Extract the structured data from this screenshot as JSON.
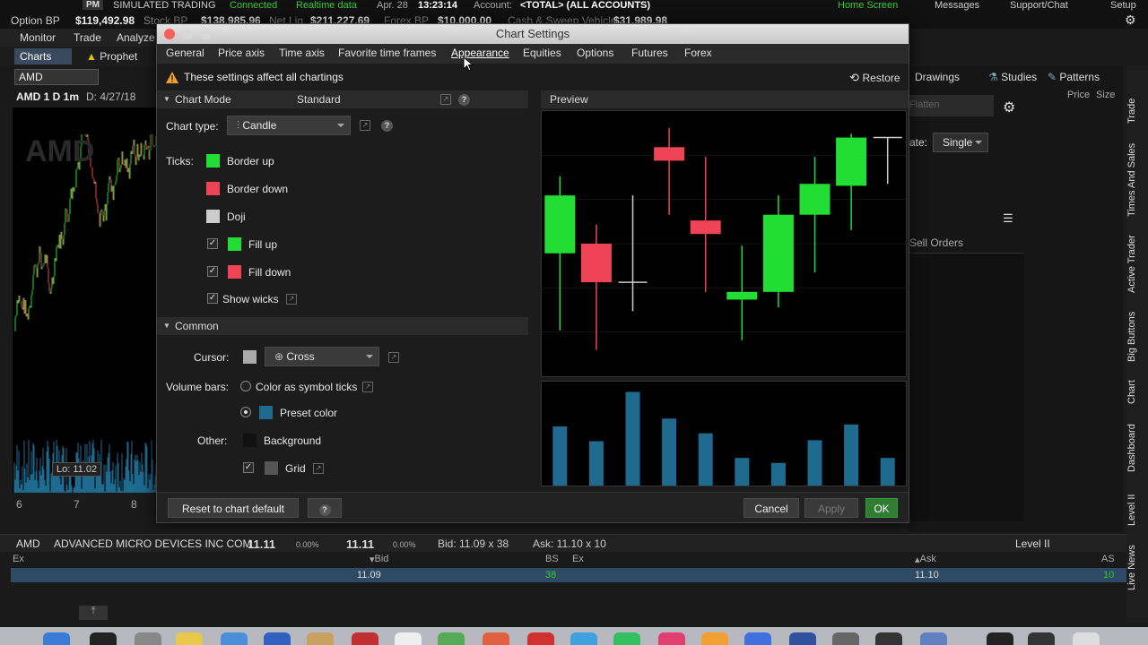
{
  "topbar": {
    "badge": "PM",
    "mode": "SIMULATED TRADING",
    "connected": "Connected",
    "realtime": "Realtime data",
    "date": "Apr. 28",
    "time": "13:23:14",
    "account_label": "Account:",
    "account_value": "<TOTAL> (ALL ACCOUNTS)",
    "home_screen": "Home Screen",
    "messages": "Messages",
    "support": "Support/Chat",
    "setup": "Setup",
    "option_bp_label": "Option BP",
    "option_bp": "$119,492.98",
    "stock_bp_label": "Stock BP",
    "stock_bp": "$138,985.96",
    "net_liq_label": "Net Liq",
    "net_liq": "$211,227.69",
    "forex_bp_label": "Forex BP",
    "forex_bp": "$10,000.00",
    "cash_label": "Cash & Sweep Vehicle",
    "cash": "$31,989.98"
  },
  "nav": {
    "monitor": "Monitor",
    "trade": "Trade",
    "analyze": "Analyze"
  },
  "subtabs": {
    "charts": "Charts",
    "prophet": "Prophet"
  },
  "left": {
    "symbol": "AMD",
    "chart_header_1": "AMD 1 D 1m",
    "chart_header_2": "D: 4/27/18",
    "watermark": "AMD",
    "lo_label": "Lo: 11.02",
    "x_ticks": [
      "6",
      "7",
      "8"
    ]
  },
  "right": {
    "drawings": "Drawings",
    "studies": "Studies",
    "patterns": "Patterns",
    "price": "Price",
    "size": "Size",
    "flatten": "Flatten",
    "rate_label": "ate:",
    "rate_value": "Single",
    "sell_orders": "Sell Orders"
  },
  "sidetabs": [
    "Trade",
    "Times And Sales",
    "Active Trader",
    "Big Buttons",
    "Chart",
    "Dashboard",
    "Level II",
    "Live News"
  ],
  "bottom": {
    "symbol": "AMD",
    "name": "ADVANCED MICRO DEVICES INC COM",
    "last": "11.11",
    "pct1": "0.00%",
    "last2": "11.11",
    "pct2": "0.00%",
    "bid": "Bid: 11.09 x 38",
    "ask": "Ask: 11.10 x 10",
    "level2": "Level II",
    "hdr_ex": "Ex",
    "hdr_bid": "Bid",
    "hdr_bs": "BS",
    "hdr_ex2": "Ex",
    "hdr_ask": "Ask",
    "hdr_as": "AS",
    "row_bid": "11.09",
    "row_bs": "38",
    "row_ask": "11.10",
    "row_as": "10"
  },
  "dialog": {
    "title": "Chart Settings",
    "tabs": [
      "General",
      "Price axis",
      "Time axis",
      "Favorite time frames",
      "Appearance",
      "Equities",
      "Options",
      "Futures",
      "Forex"
    ],
    "active_tab": "Appearance",
    "warning": "These settings affect all chartings",
    "restore": "Restore",
    "chart_mode_label": "Chart Mode",
    "chart_mode_value": "Standard",
    "chart_type_label": "Chart type:",
    "chart_type_value": "Candle",
    "ticks_label": "Ticks:",
    "border_up": "Border up",
    "border_down": "Border down",
    "doji": "Doji",
    "fill_up": "Fill up",
    "fill_down": "Fill down",
    "show_wicks": "Show wicks",
    "common_label": "Common",
    "cursor_label": "Cursor:",
    "cursor_value": "Cross",
    "volume_label": "Volume bars:",
    "color_as_symbol": "Color as symbol ticks",
    "preset_color": "Preset color",
    "other_label": "Other:",
    "background": "Background",
    "grid": "Grid",
    "preview_label": "Preview",
    "reset_button": "Reset to chart default",
    "cancel_button": "Cancel",
    "apply_button": "Apply",
    "ok_button": "OK"
  },
  "colors": {
    "up": "#22dd33",
    "down": "#ee4455",
    "doji": "#cccccc",
    "volume": "#1f6a8f",
    "accent_ok": "#2f7d32"
  },
  "preview_candles": [
    {
      "o": 6,
      "h": 10,
      "l": 2,
      "c": 9,
      "up": true
    },
    {
      "o": 6.5,
      "h": 7.5,
      "l": 1,
      "c": 4.5,
      "up": false
    },
    {
      "o": 4.5,
      "h": 9,
      "l": 3,
      "c": 4.5,
      "up": null
    },
    {
      "o": 11.5,
      "h": 12.5,
      "l": 8,
      "c": 10.8,
      "up": false
    },
    {
      "o": 7.7,
      "h": 11,
      "l": 4,
      "c": 7,
      "up": false
    },
    {
      "o": 3.6,
      "h": 6.4,
      "l": 1.5,
      "c": 4,
      "up": true
    },
    {
      "o": 4,
      "h": 9,
      "l": 3.2,
      "c": 8,
      "up": true
    },
    {
      "o": 8,
      "h": 11,
      "l": 5,
      "c": 9.6,
      "up": true
    },
    {
      "o": 9.5,
      "h": 12.2,
      "l": 7.2,
      "c": 12,
      "up": true
    },
    {
      "o": 12,
      "h": 12,
      "l": 9.6,
      "c": 12,
      "up": null
    }
  ],
  "preview_volume": [
    6,
    4.5,
    9.5,
    6.8,
    5.3,
    2.8,
    2.3,
    4.6,
    6.2,
    2.8
  ]
}
